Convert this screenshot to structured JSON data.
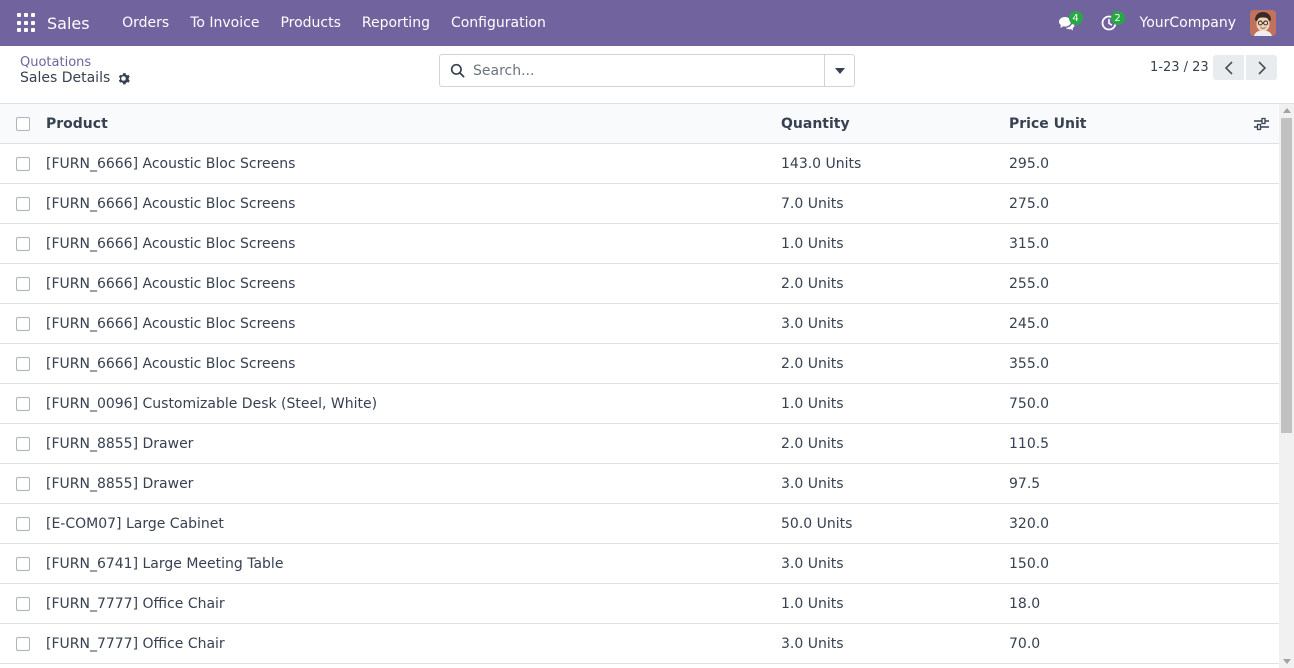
{
  "navbar": {
    "app_name": "Sales",
    "menu": [
      "Orders",
      "To Invoice",
      "Products",
      "Reporting",
      "Configuration"
    ],
    "messages_count": "4",
    "activities_count": "2",
    "company": "YourCompany"
  },
  "control": {
    "breadcrumb": "Quotations",
    "title": "Sales Details",
    "search_placeholder": "Search...",
    "pager": "1-23 / 23"
  },
  "table": {
    "columns": {
      "product": "Product",
      "quantity": "Quantity",
      "price": "Price Unit"
    },
    "rows": [
      {
        "product": "[FURN_6666] Acoustic Bloc Screens",
        "quantity": "143.0 Units",
        "price": "295.0"
      },
      {
        "product": "[FURN_6666] Acoustic Bloc Screens",
        "quantity": "7.0 Units",
        "price": "275.0"
      },
      {
        "product": "[FURN_6666] Acoustic Bloc Screens",
        "quantity": "1.0 Units",
        "price": "315.0"
      },
      {
        "product": "[FURN_6666] Acoustic Bloc Screens",
        "quantity": "2.0 Units",
        "price": "255.0"
      },
      {
        "product": "[FURN_6666] Acoustic Bloc Screens",
        "quantity": "3.0 Units",
        "price": "245.0"
      },
      {
        "product": "[FURN_6666] Acoustic Bloc Screens",
        "quantity": "2.0 Units",
        "price": "355.0"
      },
      {
        "product": "[FURN_0096] Customizable Desk (Steel, White)",
        "quantity": "1.0 Units",
        "price": "750.0"
      },
      {
        "product": "[FURN_8855] Drawer",
        "quantity": "2.0 Units",
        "price": "110.5"
      },
      {
        "product": "[FURN_8855] Drawer",
        "quantity": "3.0 Units",
        "price": "97.5"
      },
      {
        "product": "[E-COM07] Large Cabinet",
        "quantity": "50.0 Units",
        "price": "320.0"
      },
      {
        "product": "[FURN_6741] Large Meeting Table",
        "quantity": "3.0 Units",
        "price": "150.0"
      },
      {
        "product": "[FURN_7777] Office Chair",
        "quantity": "1.0 Units",
        "price": "18.0"
      },
      {
        "product": "[FURN_7777] Office Chair",
        "quantity": "3.0 Units",
        "price": "70.0"
      }
    ]
  },
  "colors": {
    "navbar": "#71639e",
    "badge": "#28a745",
    "link": "#71639e"
  }
}
